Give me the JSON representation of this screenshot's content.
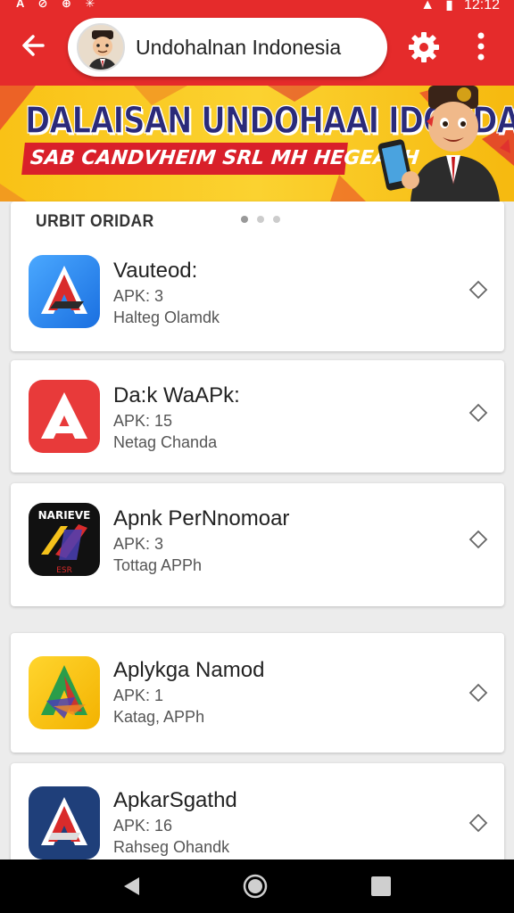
{
  "status_bar": {
    "left_icons": "A ⊘ ⊕ ✳",
    "time": "12:12"
  },
  "app_bar": {
    "title": "Undohalnan Indonesia"
  },
  "banner": {
    "title": "DALAISAN UNDOHAAI IDONDAN",
    "subtitle": "SAB CANDVHEIM SRL MH HEGEASH"
  },
  "section": {
    "header": "URBIT ORIDAR"
  },
  "apps": [
    {
      "name": "Vauteod:",
      "version": "APK: 3",
      "meta": "Halteg Olamdk",
      "icon": "vauteod-app-icon"
    },
    {
      "name": "Da:k WaAPk:",
      "version": "APK: 15",
      "meta": "Netag Chanda",
      "icon": "dark-wa-app-icon"
    },
    {
      "name": "Apnk PerNnomoar",
      "version": "APK: 3",
      "meta": "Tottag APPh",
      "icon": "apnk-app-icon",
      "icon_text": "NARIEVE",
      "icon_subtext": "ESR"
    },
    {
      "name": "Aplykga Namod",
      "version": "APK: 1",
      "meta": "Katag, APPh",
      "icon": "aplykga-app-icon"
    },
    {
      "name": "ApkarSgathd",
      "version": "APK: 16",
      "meta": "Rahseg Ohandk",
      "icon": "apkar-app-icon"
    }
  ],
  "colors": {
    "primary": "#e52b2b",
    "banner_yellow": "#f9c216",
    "banner_text": "#2a2a7a"
  }
}
